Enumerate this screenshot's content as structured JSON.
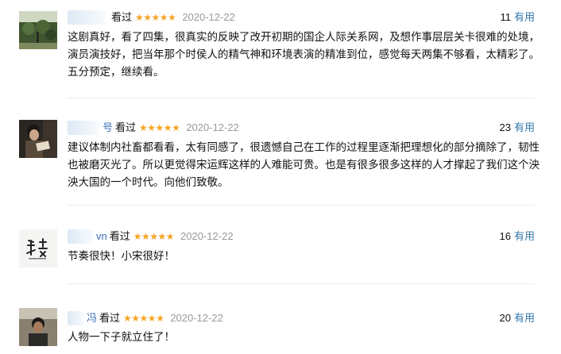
{
  "colors": {
    "star": "#f5a623",
    "link": "#3377aa",
    "date": "#999999",
    "divider": "#ececec"
  },
  "reviews": [
    {
      "name_fragment": "",
      "action": "看过",
      "stars": "★★★★★",
      "date": "2020-12-22",
      "votes": "11",
      "useful_label": "有用",
      "content": "这剧真好，看了四集，很真实的反映了改开初期的国企人际关系网，及想作事层层关卡很难的处境，演员演技好，把当年那个时侯人的精气神和环境表演的精准到位，感觉每天两集不够看，太精彩了。五分预定，继续看。",
      "avatar_icon": "garden-photo-avatar"
    },
    {
      "name_fragment": "号",
      "action": "看过",
      "stars": "★★★★★",
      "date": "2020-12-22",
      "votes": "23",
      "useful_label": "有用",
      "content": "建议体制内社畜都看看，太有同感了，很遗憾自己在工作的过程里逐渐把理想化的部分摘除了，韧性也被磨灭光了。所以更觉得宋运辉这样的人难能可贵。也是有很多很多这样的人才撑起了我们这个泱泱大国的一个时代。向他们致敬。",
      "avatar_icon": "person-reading-avatar"
    },
    {
      "name_fragment": "vn",
      "action": "看过",
      "stars": "★★★★★",
      "date": "2020-12-22",
      "votes": "16",
      "useful_label": "有用",
      "content": "节奏很快！小宋很好！",
      "avatar_icon": "calligraphy-avatar"
    },
    {
      "name_fragment": "冯",
      "action": "看过",
      "stars": "★★★★★",
      "date": "2020-12-22",
      "votes": "20",
      "useful_label": "有用",
      "content": "人物一下子就立住了！",
      "avatar_icon": "boy-photo-avatar"
    }
  ]
}
